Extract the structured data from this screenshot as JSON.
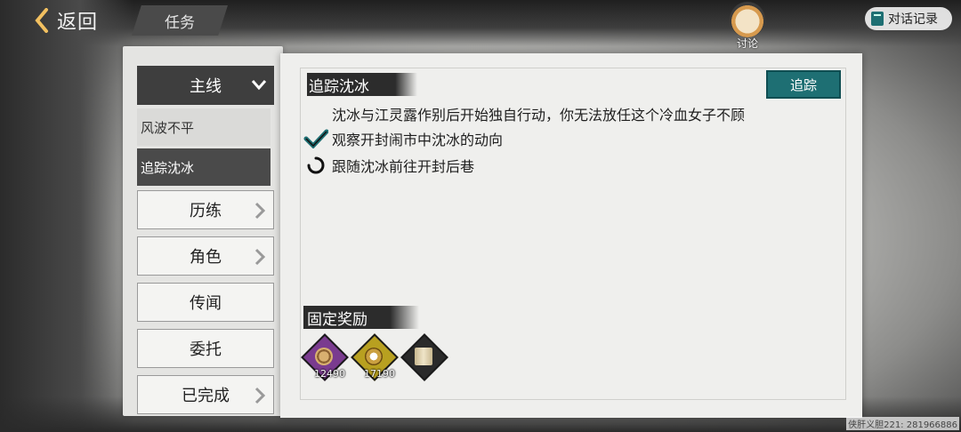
{
  "topbar": {
    "back_label": "返回",
    "page_title": "任务",
    "discuss_label": "讨论",
    "log_label": "对话记录"
  },
  "sidebar": {
    "main_label": "主线",
    "sub_items": [
      {
        "label": "风波不平",
        "active": false
      },
      {
        "label": "追踪沈冰",
        "active": true
      }
    ],
    "categories": [
      {
        "label": "历练"
      },
      {
        "label": "角色"
      },
      {
        "label": "传闻"
      },
      {
        "label": "委托"
      },
      {
        "label": "已完成"
      }
    ]
  },
  "quest": {
    "title": "追踪沈冰",
    "track_label": "追踪",
    "description": "沈冰与江灵露作别后开始独自行动，你无法放任这个冷血女子不顾",
    "objectives": [
      {
        "text": "观察开封闹市中沈冰的动向",
        "status": "done",
        "icon": "checkmark-icon"
      },
      {
        "text": "跟随沈冰前往开封后巷",
        "status": "in-progress",
        "icon": "progress-ring-icon"
      }
    ]
  },
  "rewards": {
    "title": "固定奖励",
    "items": [
      {
        "icon": "coin-icon",
        "count": "12490",
        "color": "#7a3b8f"
      },
      {
        "icon": "experience-icon",
        "count": "17190",
        "color": "#b8a020"
      },
      {
        "icon": "scroll-icon",
        "count": "",
        "color": "#2a2a2a"
      }
    ]
  },
  "watermark": "侠肝义胆221: 281966886",
  "colors": {
    "track_button": "#1e6f73",
    "selected_dark": "#3e3e3e"
  }
}
